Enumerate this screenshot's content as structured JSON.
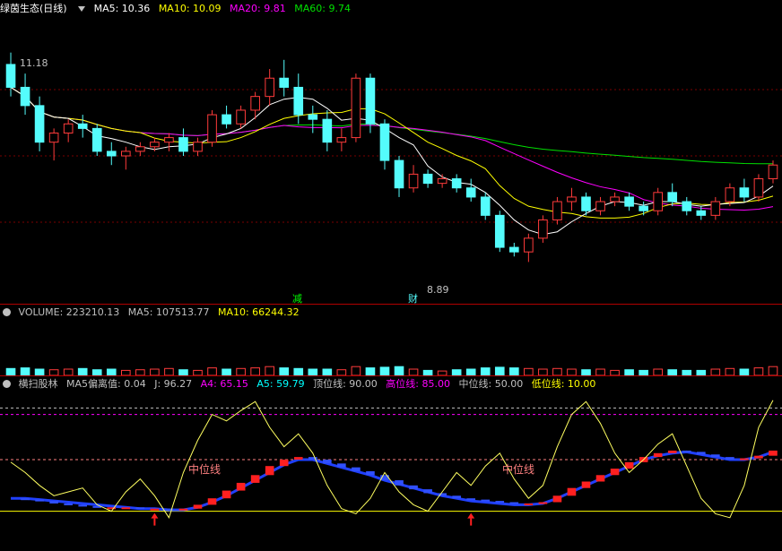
{
  "main_panel": {
    "stock_name": "绿茵生态(日线)",
    "ma5": "MA5: 10.36",
    "ma10": "MA10: 10.09",
    "ma20": "MA20: 9.81",
    "ma60": "MA60: 9.74",
    "high_label": "11.18",
    "low_label": "8.89",
    "marker_jian": "减",
    "marker_cai": "财"
  },
  "volume_panel": {
    "volume": "VOLUME: 223210.13",
    "ma5": "MA5: 107513.77",
    "ma10": "MA10: 66244.32"
  },
  "indicator_panel": {
    "name": "横扫股林",
    "ma5_dev": "MA5偏离值: 0.04",
    "j": "J: 96.27",
    "a4": "A4: 65.15",
    "a5": "A5: 59.79",
    "top": "顶位线: 90.00",
    "high": "高位线: 85.00",
    "mid": "中位线: 50.00",
    "low": "低位线: 10.00",
    "mid_label_1": "中位线",
    "mid_label_2": "中位线"
  },
  "colors": {
    "up": "#ff3b3b",
    "down": "#54fcfc",
    "ma5": "#ffffff",
    "ma10": "#ffff00",
    "ma20": "#ff00ff",
    "ma60": "#00e000",
    "grid": "#7a0000"
  },
  "chart_data": {
    "type": "candlestick",
    "price_range": [
      8.6,
      11.5
    ],
    "candles_ohlc": [
      [
        11.05,
        11.18,
        10.7,
        10.8
      ],
      [
        10.8,
        10.95,
        10.5,
        10.6
      ],
      [
        10.6,
        10.7,
        10.1,
        10.2
      ],
      [
        10.2,
        10.35,
        10.0,
        10.3
      ],
      [
        10.3,
        10.45,
        10.2,
        10.4
      ],
      [
        10.4,
        10.5,
        10.25,
        10.35
      ],
      [
        10.35,
        10.4,
        10.05,
        10.1
      ],
      [
        10.1,
        10.2,
        9.95,
        10.05
      ],
      [
        10.05,
        10.15,
        9.9,
        10.1
      ],
      [
        10.1,
        10.2,
        10.05,
        10.15
      ],
      [
        10.15,
        10.25,
        10.1,
        10.2
      ],
      [
        10.2,
        10.3,
        10.1,
        10.25
      ],
      [
        10.25,
        10.35,
        10.05,
        10.1
      ],
      [
        10.1,
        10.25,
        10.05,
        10.2
      ],
      [
        10.2,
        10.55,
        10.15,
        10.5
      ],
      [
        10.5,
        10.6,
        10.35,
        10.4
      ],
      [
        10.4,
        10.6,
        10.35,
        10.55
      ],
      [
        10.55,
        10.75,
        10.45,
        10.7
      ],
      [
        10.7,
        11.0,
        10.6,
        10.9
      ],
      [
        10.9,
        11.1,
        10.7,
        10.8
      ],
      [
        10.8,
        10.95,
        10.4,
        10.5
      ],
      [
        10.5,
        10.6,
        10.3,
        10.45
      ],
      [
        10.45,
        10.55,
        10.1,
        10.2
      ],
      [
        10.2,
        10.35,
        10.1,
        10.25
      ],
      [
        10.25,
        10.95,
        10.2,
        10.9
      ],
      [
        10.9,
        10.95,
        10.3,
        10.4
      ],
      [
        10.4,
        10.45,
        9.9,
        10.0
      ],
      [
        10.0,
        10.05,
        9.6,
        9.7
      ],
      [
        9.7,
        9.95,
        9.65,
        9.85
      ],
      [
        9.85,
        9.9,
        9.7,
        9.75
      ],
      [
        9.75,
        9.85,
        9.7,
        9.8
      ],
      [
        9.8,
        9.85,
        9.65,
        9.7
      ],
      [
        9.7,
        9.8,
        9.55,
        9.6
      ],
      [
        9.6,
        9.65,
        9.35,
        9.4
      ],
      [
        9.4,
        9.45,
        9.0,
        9.05
      ],
      [
        9.05,
        9.1,
        8.95,
        9.0
      ],
      [
        9.0,
        9.2,
        8.89,
        9.15
      ],
      [
        9.15,
        9.4,
        9.1,
        9.35
      ],
      [
        9.35,
        9.6,
        9.3,
        9.55
      ],
      [
        9.55,
        9.7,
        9.45,
        9.6
      ],
      [
        9.6,
        9.65,
        9.4,
        9.45
      ],
      [
        9.45,
        9.6,
        9.4,
        9.55
      ],
      [
        9.55,
        9.65,
        9.5,
        9.6
      ],
      [
        9.6,
        9.65,
        9.45,
        9.5
      ],
      [
        9.5,
        9.55,
        9.4,
        9.45
      ],
      [
        9.45,
        9.7,
        9.4,
        9.65
      ],
      [
        9.65,
        9.75,
        9.5,
        9.55
      ],
      [
        9.55,
        9.6,
        9.4,
        9.45
      ],
      [
        9.45,
        9.5,
        9.35,
        9.4
      ],
      [
        9.4,
        9.6,
        9.35,
        9.55
      ],
      [
        9.55,
        9.75,
        9.5,
        9.7
      ],
      [
        9.7,
        9.8,
        9.55,
        9.6
      ],
      [
        9.6,
        9.85,
        9.55,
        9.8
      ],
      [
        9.8,
        10.0,
        9.75,
        9.95
      ]
    ],
    "volume_max": 223210.13,
    "volumes": [
      0.55,
      0.6,
      0.5,
      0.45,
      0.5,
      0.55,
      0.45,
      0.5,
      0.4,
      0.45,
      0.5,
      0.55,
      0.45,
      0.4,
      0.6,
      0.5,
      0.55,
      0.6,
      0.7,
      0.6,
      0.55,
      0.5,
      0.5,
      0.45,
      0.7,
      0.6,
      0.65,
      0.7,
      0.5,
      0.4,
      0.35,
      0.45,
      0.5,
      0.6,
      0.65,
      0.6,
      0.55,
      0.5,
      0.55,
      0.5,
      0.45,
      0.5,
      0.4,
      0.45,
      0.4,
      0.5,
      0.45,
      0.4,
      0.4,
      0.5,
      0.55,
      0.5,
      0.6,
      0.7
    ],
    "indicator_range": [
      0,
      100
    ],
    "j_line": [
      48,
      40,
      30,
      22,
      25,
      28,
      15,
      10,
      25,
      35,
      22,
      5,
      40,
      65,
      85,
      80,
      88,
      95,
      75,
      60,
      70,
      55,
      30,
      12,
      8,
      20,
      40,
      25,
      15,
      10,
      25,
      40,
      30,
      45,
      55,
      35,
      20,
      30,
      60,
      85,
      95,
      78,
      55,
      40,
      50,
      62,
      70,
      45,
      20,
      8,
      5,
      30,
      75,
      96
    ],
    "a4_line": [
      20,
      19,
      18,
      16,
      15,
      14,
      13,
      13,
      13,
      12,
      12,
      11,
      12,
      15,
      20,
      26,
      32,
      38,
      45,
      50,
      52,
      50,
      47,
      44,
      41,
      38,
      34,
      30,
      27,
      24,
      22,
      20,
      19,
      18,
      17,
      16,
      16,
      17,
      22,
      28,
      33,
      38,
      43,
      48,
      52,
      55,
      57,
      56,
      54,
      52,
      50,
      51,
      53,
      57
    ],
    "a5_line": [
      20,
      20,
      19,
      18,
      17,
      16,
      15,
      14,
      13,
      12,
      12,
      11,
      11,
      13,
      17,
      22,
      28,
      34,
      40,
      46,
      50,
      50,
      47,
      44,
      41,
      38,
      34,
      31,
      28,
      25,
      22,
      20,
      18,
      17,
      16,
      15,
      15,
      16,
      20,
      25,
      30,
      35,
      40,
      45,
      50,
      53,
      55,
      56,
      54,
      52,
      50,
      50,
      52,
      56
    ]
  }
}
